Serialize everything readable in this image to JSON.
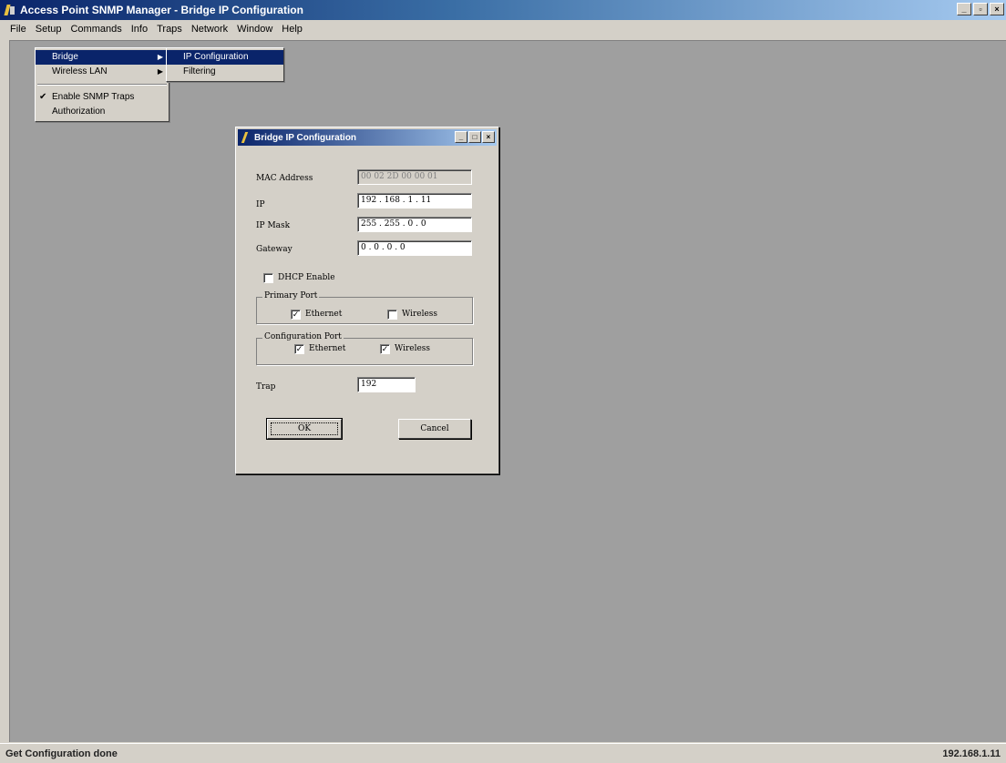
{
  "window": {
    "title": "Access Point SNMP Manager - Bridge IP Configuration",
    "buttons": [
      "_",
      "&#9633;",
      "×"
    ]
  },
  "menubar": [
    "File",
    "Setup",
    "Commands",
    "Info",
    "Traps",
    "Network",
    "Window",
    "Help"
  ],
  "setup_menu": {
    "items": [
      {
        "label": "Bridge",
        "arrow": "▶"
      },
      {
        "label": "Wireless LAN",
        "arrow": "▶"
      },
      {
        "label": "Enable SNMP Traps",
        "check": "✔"
      },
      {
        "label": "Authorization"
      }
    ]
  },
  "bridge_submenu": {
    "items": [
      "IP Configuration",
      "Filtering"
    ]
  },
  "dialog": {
    "title": "Bridge IP Configuration",
    "buttons": [
      "_",
      "□",
      "×"
    ],
    "mac_label": "MAC Address",
    "mac_value": "00 02 2D 00 00 01",
    "ip_label": "IP",
    "ip_value": "192 . 168 .  1  . 11",
    "mask_label": "IP Mask",
    "mask_value": "255 . 255 .  0  .  0",
    "gateway_label": "Gateway",
    "gateway_value": " 0  .  0  .  0  .  0",
    "dhcp_label": "DHCP Enable",
    "dhcp_checked": "",
    "primary_port_label": "Primary Port",
    "primary_ethernet_label": "Ethernet",
    "primary_ethernet_mark": "✓",
    "primary_wireless_label": "Wireless",
    "primary_wireless_mark": "",
    "config_port_label": "Configuration Port",
    "config_ethernet_label": "Ethernet",
    "config_ethernet_mark": "✓",
    "config_wireless_label": "Wireless",
    "config_wireless_mark": "✓",
    "trap_label": "Trap",
    "trap_value": "192",
    "ok_label": "OK",
    "cancel_label": "Cancel"
  },
  "status": {
    "left": "Get Configuration done",
    "right": "192.168.1.11"
  }
}
